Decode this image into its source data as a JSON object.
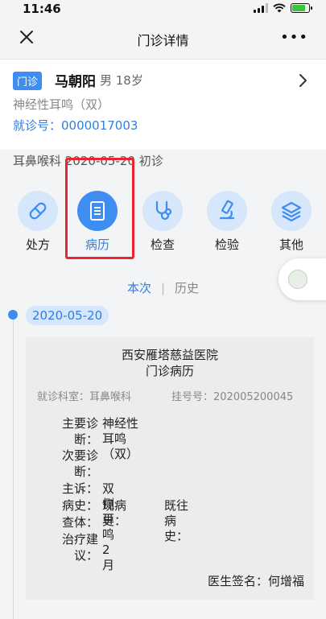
{
  "status": {
    "time": "11:46",
    "battery_color": "#3cc43c",
    "battery_level": 0.8
  },
  "nav": {
    "title": "门诊详情",
    "close_icon": "close-icon",
    "more_label": "•••"
  },
  "patient": {
    "tag": "门诊",
    "name": "马朝阳",
    "info": "男 18岁",
    "diagnosis": "神经性耳鸣（双）",
    "visit_no": "就诊号：0000017003"
  },
  "dept_line": "耳鼻喉科 2020-05-20 初诊",
  "functions": [
    {
      "label": "处方",
      "icon": "pill-icon"
    },
    {
      "label": "病历",
      "icon": "document-icon",
      "active": true
    },
    {
      "label": "检查",
      "icon": "stethoscope-icon"
    },
    {
      "label": "检验",
      "icon": "microscope-icon"
    },
    {
      "label": "其他",
      "icon": "layers-icon"
    }
  ],
  "toggle": {
    "current": "本次",
    "separator": "|",
    "history": "历史"
  },
  "timeline": {
    "date": "2020-05-20"
  },
  "record": {
    "hospital": "西安雁塔慈益医院",
    "record_title": "门诊病历",
    "dept": "就诊科室：耳鼻喉科",
    "reg_no": "挂号号：202005200045",
    "main_diag_label_1": "主要诊",
    "main_diag_label_2": "断：",
    "main_diag_value": "神经性耳鸣（双）",
    "sub_diag_label_1": "次要诊",
    "sub_diag_label_2": "断：",
    "complaint_label": "主诉：",
    "complaint_value": "双侧耳鸣2月",
    "history_label": "病史：",
    "present_history": "现病史：",
    "past_history": "既往病史：",
    "exam_label": "查体：",
    "treat_label_1": "治疗建",
    "treat_label_2": "议：",
    "signature": "医生签名：何增福"
  },
  "colors": {
    "accent": "#3d8ef0",
    "highlight": "#e8262b",
    "link": "#2f7ee6"
  }
}
